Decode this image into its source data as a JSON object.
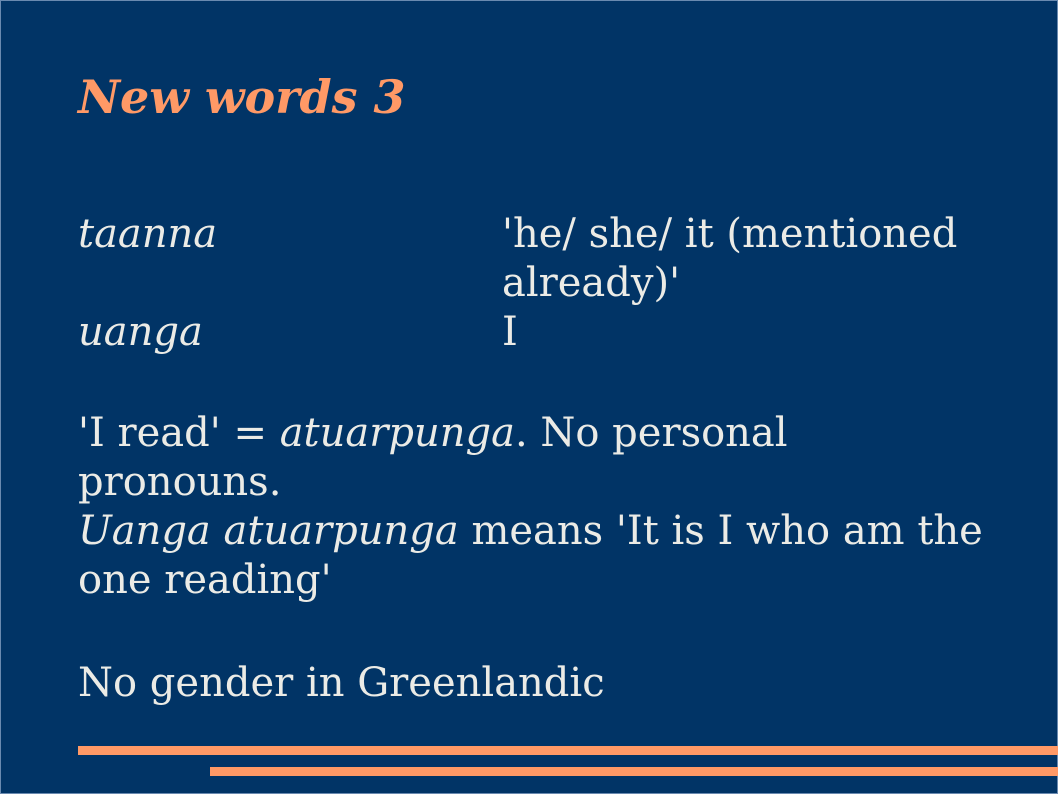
{
  "slide": {
    "title": "New words 3",
    "vocabulary": [
      {
        "term": "taanna",
        "definition": "'he/ she/ it (mentioned already)'"
      },
      {
        "term": "uanga",
        "definition": "I"
      }
    ],
    "paragraph1": {
      "line1_prefix": "'I read' = ",
      "line1_italic": "atuarpunga",
      "line1_suffix": ". No personal pronouns.",
      "line2_italic": "Uanga atuarpunga",
      "line2_suffix": " means 'It is I who am the one reading'"
    },
    "paragraph2": "No gender in Greenlandic",
    "colors": {
      "background": "#013466",
      "accent": "#ff9966",
      "text": "#ebebe6"
    }
  }
}
